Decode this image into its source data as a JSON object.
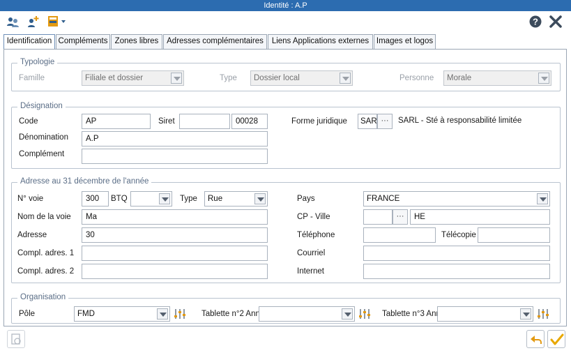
{
  "window": {
    "title": "Identité : A.P"
  },
  "colors": {
    "titlebar": "#2c6cb0",
    "accent_orange": "#e39a12",
    "check_yellow": "#e8a800"
  },
  "tabs": [
    {
      "label": "Identification",
      "active": true
    },
    {
      "label": "Compléments"
    },
    {
      "label": "Zones libres"
    },
    {
      "label": "Adresses complémentaires"
    },
    {
      "label": "Liens Applications externes"
    },
    {
      "label": "Images et logos"
    }
  ],
  "typologie": {
    "legend": "Typologie",
    "famille_label": "Famille",
    "famille_value": "Filiale et dossier",
    "type_label": "Type",
    "type_value": "Dossier local",
    "personne_label": "Personne",
    "personne_value": "Morale"
  },
  "designation": {
    "legend": "Désignation",
    "code_label": "Code",
    "code_value": "AP",
    "siret_label": "Siret",
    "siret_value": "",
    "siret_suffix": "00028",
    "forme_label": "Forme juridique",
    "forme_code": "SAR",
    "forme_desc": "SARL - Sté à responsabilité limitée",
    "denomination_label": "Dénomination",
    "denomination_value": "A.P",
    "complement_label": "Complément",
    "complement_value": ""
  },
  "adresse": {
    "legend": "Adresse au 31 décembre de l'année",
    "voie_label": "N° voie",
    "voie_value": "300",
    "btq_label": "BTQ",
    "btq_value": "",
    "type_label": "Type",
    "type_value": "Rue",
    "pays_label": "Pays",
    "pays_value": "FRANCE",
    "nomvoie_label": "Nom de la voie",
    "nomvoie_value": "Ma",
    "cpville_label": "CP - Ville",
    "cp_value": "",
    "ville_value": "HE",
    "adresse_label": "Adresse",
    "adresse_value": "30",
    "tel_label": "Téléphone",
    "tel_value": "",
    "fax_label": "Télécopie",
    "fax_value": "",
    "compl1_label": "Compl. adres. 1",
    "compl1_value": "",
    "courriel_label": "Courriel",
    "courriel_value": "",
    "compl2_label": "Compl. adres. 2",
    "compl2_value": "",
    "internet_label": "Internet",
    "internet_value": ""
  },
  "organisation": {
    "legend": "Organisation",
    "pole_label": "Pôle",
    "pole_value": "FMD",
    "tab2_label": "Tablette n°2 Ann",
    "tab2_value": "",
    "tab3_label": "Tablette n°3 Ann",
    "tab3_value": ""
  }
}
